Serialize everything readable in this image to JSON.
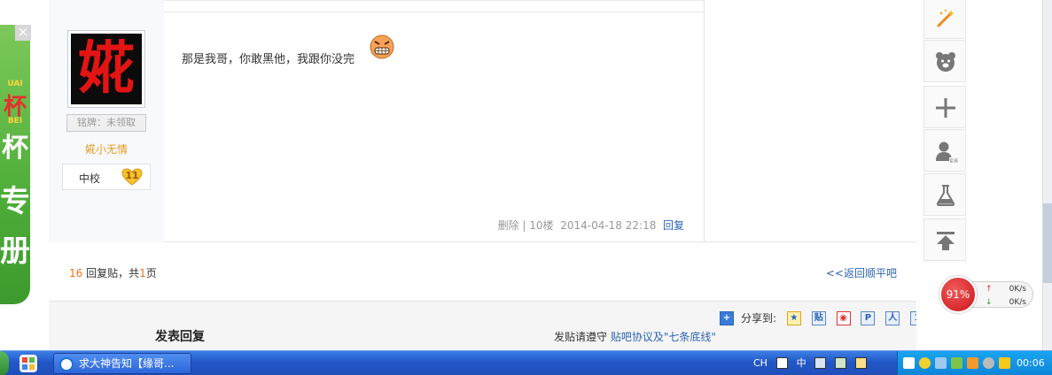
{
  "ad": {
    "close_glyph": "×",
    "text_fragments": [
      "UAI",
      "杯",
      "BEI",
      "杯",
      "专",
      "册"
    ]
  },
  "post": {
    "avatar_char": "婲",
    "badge_label": "铭牌：未领取",
    "username": "婲小无情",
    "level_name": "中校",
    "level_number": "11",
    "content": "那是我哥，你敢黑他，我跟你没完",
    "emoji": "grinning-face-emoji",
    "meta_delete": "删除",
    "meta_sep": "|",
    "meta_floor": "10楼",
    "meta_time": "2014-04-18 22:18",
    "meta_reply": "回复"
  },
  "pager": {
    "reply_count": "16",
    "reply_text": "回复贴，共",
    "page_count": "1",
    "page_unit": "页",
    "back_link": "<<返回顺平吧"
  },
  "compose": {
    "title": "发表回复",
    "share_label": "分享到:",
    "share_icons": [
      "qzone-icon",
      "tieba-icon",
      "weibo-icon",
      "pengyou-icon",
      "renren-icon",
      "kaixin-icon"
    ],
    "rules_prefix": "发贴请遵守",
    "rules_link": "贴吧协议及\"七条底线\""
  },
  "right_tools": [
    "magic-wand-icon",
    "bear-face-icon",
    "plus-icon",
    "user-icon",
    "lab-flask-icon",
    "back-to-top-icon"
  ],
  "speed": {
    "percent": "91%",
    "up": "0K/s",
    "down": "0K/s"
  },
  "taskbar": {
    "task_title": "求大神告知【缘哥...",
    "lang": "CH",
    "ime": "中",
    "clock": "00:06"
  },
  "colors": {
    "accent_link": "#2d64b3",
    "count_orange": "#e8741a",
    "username_orange": "#e89a1c",
    "taskbar_blue": "#2357c8"
  }
}
